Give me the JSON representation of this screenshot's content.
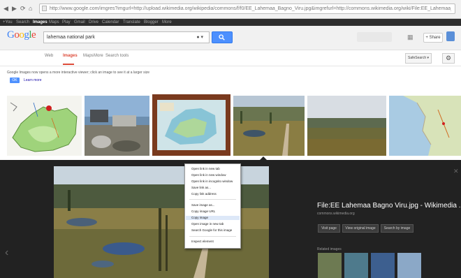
{
  "browser": {
    "url": "http://www.google.com/imgres?imgurl=http://upload.wikimedia.org/wikipedia/commons/f/f0/EE_Lahemaa_Bagno_Viru.jpg&imgrefurl=http://commons.wikimedia.org/wiki/File:EE_Lahemaa_Bagno_Viru.jpg",
    "nav_icons": [
      "back-icon",
      "forward-icon",
      "reload-icon",
      "home-icon"
    ]
  },
  "google_bar": {
    "items": [
      "+You",
      "Search",
      "Images",
      "Maps",
      "Play",
      "Gmail",
      "Drive",
      "Calendar",
      "Translate",
      "Blogger",
      "More"
    ],
    "active_index": 2
  },
  "header": {
    "logo_letters": [
      {
        "ch": "G",
        "color": "#4285f4"
      },
      {
        "ch": "o",
        "color": "#ea4335"
      },
      {
        "ch": "o",
        "color": "#fbbc05"
      },
      {
        "ch": "g",
        "color": "#4285f4"
      },
      {
        "ch": "l",
        "color": "#34a853"
      },
      {
        "ch": "e",
        "color": "#ea4335"
      }
    ],
    "query": "lahemaa national park",
    "share_label": "+ Share"
  },
  "tabs": {
    "items": [
      "Web",
      "Images",
      "Maps",
      "More",
      "Search tools"
    ],
    "active_index": 1,
    "safesearch_label": "SafeSearch ▾"
  },
  "notice": {
    "text": "Google Images now opens a more interactive viewer; click an image to see it at a larger size",
    "ok_label": "OK",
    "learn_more": "Learn more"
  },
  "viewer": {
    "title": "File:EE Lahemaa Bagno Viru.jpg - Wikimedia ...",
    "source": "commons.wikimedia.org",
    "buttons": [
      "Visit page",
      "View original image",
      "Search by image"
    ],
    "related_label": "Related images"
  },
  "context_menu": {
    "items": [
      "Open link in new tab",
      "Open link in new window",
      "Open link in incognito window",
      "Save link as...",
      "Copy link address",
      "Save image as...",
      "Copy image URL",
      "Copy image",
      "Open image in new tab",
      "Search Google for this image",
      "Inspect element"
    ],
    "highlighted_index": 7
  },
  "colors": {
    "accent_blue": "#4d90fe",
    "active_tab_red": "#dd4b39",
    "viewer_bg": "#222222"
  }
}
